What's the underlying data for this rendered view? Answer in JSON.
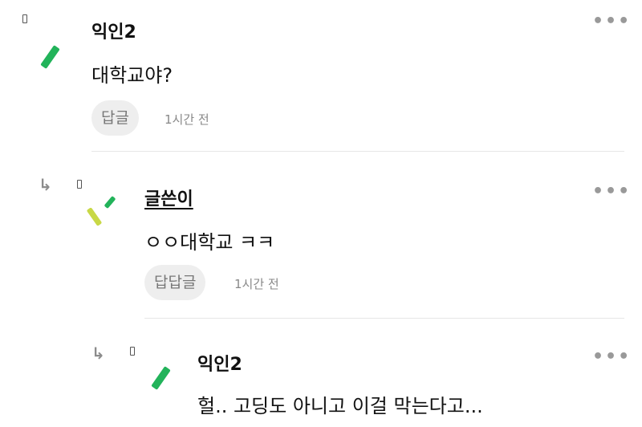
{
  "comments": [
    {
      "author": "익인2",
      "text": "대학교야?",
      "reply_label": "답글",
      "time": "1시간 전"
    },
    {
      "author": "글쓴이",
      "text": "ㅇㅇ대학교 ㅋㅋ",
      "reply_label": "답답글",
      "time": "1시간 전"
    },
    {
      "author": "익인2",
      "text": "헐.. 고딩도 아니고 이걸 막는다고..."
    }
  ],
  "icons": {
    "more": "more-dots-icon",
    "reply_arrow": "reply-arrow-icon"
  },
  "colors": {
    "avatar_green": "#22b35a",
    "avatar_yellow": "#c8d846",
    "reply_bg": "#eeeeee"
  }
}
